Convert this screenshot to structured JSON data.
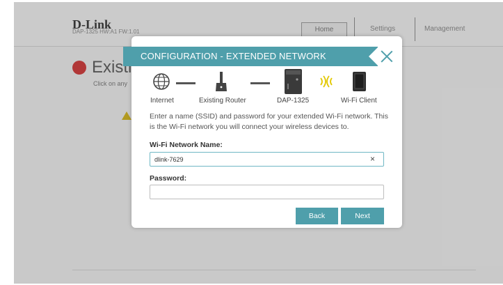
{
  "header": {
    "logo": "D-Link",
    "model_info": "DAP-1325   HW:A1   FW:1.01",
    "nav": {
      "home": "Home",
      "settings": "Settings",
      "management": "Management"
    }
  },
  "page": {
    "title": "Existi",
    "subtitle": "Click on any"
  },
  "modal": {
    "title": "CONFIGURATION - EXTENDED NETWORK",
    "topology": {
      "internet": "Internet",
      "router": "Existing Router",
      "extender": "DAP-1325",
      "client": "Wi-Fi Client"
    },
    "description": "Enter a name (SSID) and password for your extended Wi-Fi network. This is the Wi-Fi network you will connect your wireless devices to.",
    "ssid_label": "Wi-Fi Network Name:",
    "ssid_value": "dlink-7629",
    "clear_glyph": "×",
    "password_label": "Password:",
    "password_value": "",
    "back_label": "Back",
    "next_label": "Next"
  },
  "colors": {
    "accent": "#4f9fab",
    "status_red": "#c81f1f",
    "wifi_yellow": "#e2c800"
  },
  "icons": [
    "globe-icon",
    "router-icon",
    "extender-icon",
    "wifi-signal-icon",
    "tablet-icon",
    "close-icon",
    "warning-icon"
  ]
}
